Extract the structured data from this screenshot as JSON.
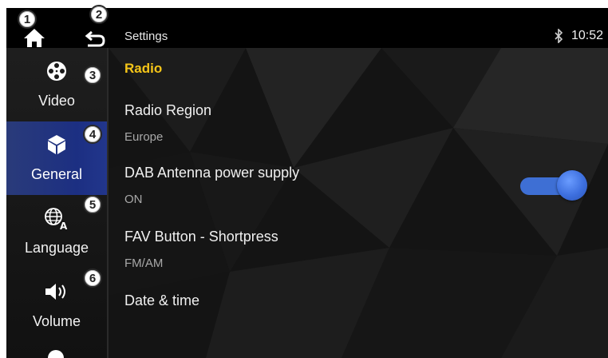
{
  "header": {
    "title": "Settings",
    "time": "10:52",
    "icons": {
      "home": "home-icon",
      "back": "back-arrow-icon",
      "bluetooth": "bluetooth-icon"
    }
  },
  "sidebar": {
    "items": [
      {
        "label": "Video",
        "icon": "film-reel-icon",
        "active": false
      },
      {
        "label": "General",
        "icon": "cube-icon",
        "active": true
      },
      {
        "label": "Language",
        "icon": "globe-language-icon",
        "active": false
      },
      {
        "label": "Volume",
        "icon": "speaker-icon",
        "active": false
      }
    ]
  },
  "main": {
    "section": "Radio",
    "settings": [
      {
        "name": "Radio Region",
        "value": "Europe"
      },
      {
        "name": "DAB Antenna power supply",
        "value": "ON",
        "toggle_on": true
      },
      {
        "name": "FAV Button - Shortpress",
        "value": "FM/AM"
      },
      {
        "name": "Date & time",
        "value": ""
      }
    ]
  },
  "callouts": [
    "1",
    "2",
    "3",
    "4",
    "5",
    "6"
  ],
  "colors": {
    "accent_yellow": "#f5c518",
    "active_nav": "#1c2f82",
    "toggle": "#3e6fd4",
    "background": "#141414"
  }
}
